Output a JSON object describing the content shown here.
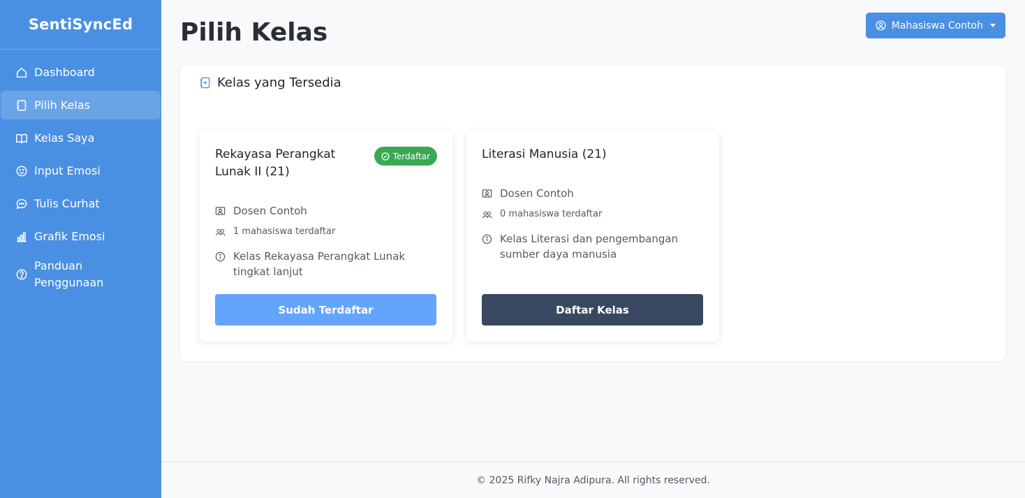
{
  "brand": "SentiSyncEd",
  "sidebar": {
    "items": [
      {
        "label": "Dashboard",
        "icon": "home-icon"
      },
      {
        "label": "Pilih Kelas",
        "icon": "notebook-icon",
        "active": true
      },
      {
        "label": "Kelas Saya",
        "icon": "book-icon"
      },
      {
        "label": "Input Emosi",
        "icon": "smile-icon"
      },
      {
        "label": "Tulis Curhat",
        "icon": "chat-icon"
      },
      {
        "label": "Grafik Emosi",
        "icon": "bar-chart-icon"
      },
      {
        "label": "Panduan Penggunaan",
        "icon": "help-icon"
      }
    ]
  },
  "header": {
    "title": "Pilih Kelas",
    "user_label": "Mahasiswa Contoh"
  },
  "panel": {
    "title": "Kelas yang Tersedia"
  },
  "classes": [
    {
      "name": "Rekayasa Perangkat Lunak II (21)",
      "badge": "Terdaftar",
      "lecturer": "Dosen Contoh",
      "students": "1 mahasiswa terdaftar",
      "description": "Kelas Rekayasa Perangkat Lunak tingkat lanjut",
      "button": "Sudah Terdaftar"
    },
    {
      "name": "Literasi Manusia (21)",
      "lecturer": "Dosen Contoh",
      "students": "0 mahasiswa terdaftar",
      "description": "Kelas Literasi dan pengembangan sumber daya manusia",
      "button": "Daftar Kelas"
    }
  ],
  "footer": "© 2025 Rifky Najra Adipura. All rights reserved.",
  "colors": {
    "sidebar": "#4a90e2",
    "badge": "#3aa853",
    "registered_button": "#63a4ff",
    "enroll_button": "#384860"
  }
}
